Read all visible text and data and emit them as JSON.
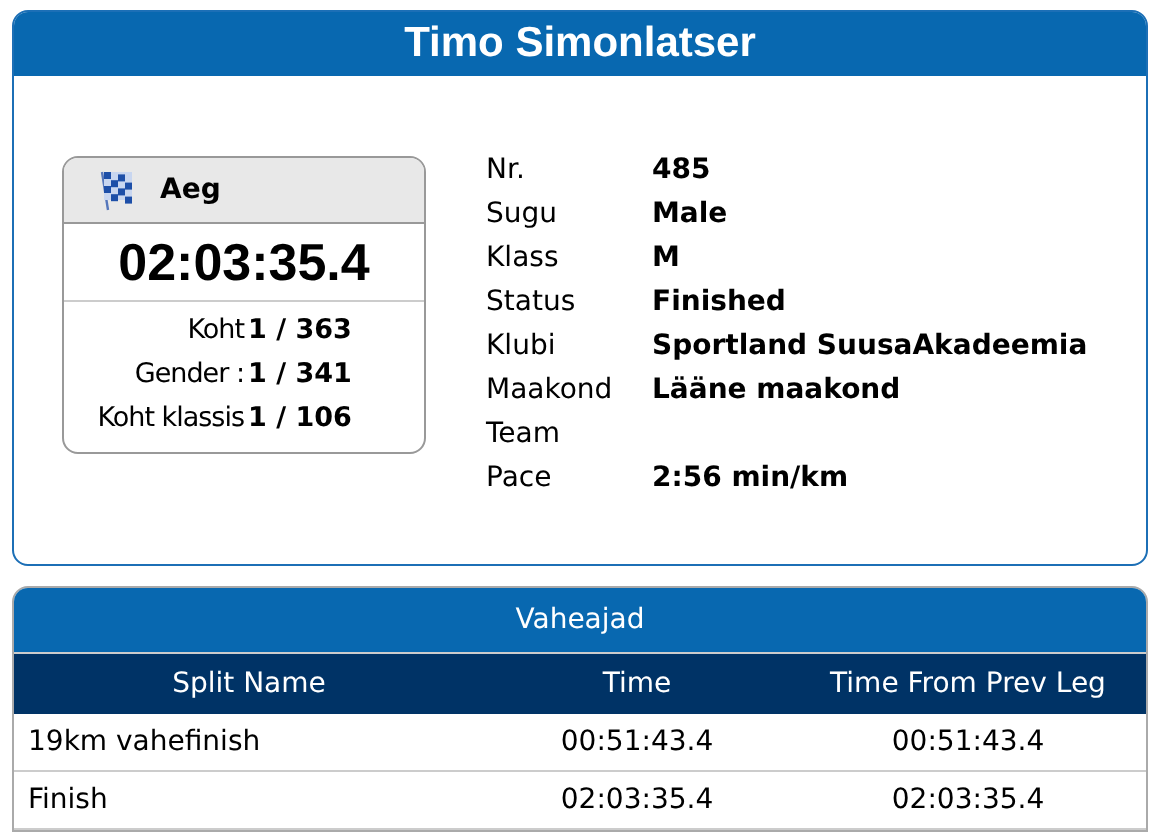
{
  "athlete": {
    "name": "Timo Simonlatser"
  },
  "result": {
    "title": "Aeg",
    "time": "02:03:35.4",
    "places": [
      {
        "label": "Koht",
        "value": "1 / 363"
      },
      {
        "label": "Gender :",
        "value": "1 / 341"
      },
      {
        "label": "Koht klassis",
        "value": "1 / 106"
      }
    ]
  },
  "details": [
    {
      "label": "Nr.",
      "value": "485"
    },
    {
      "label": "Sugu",
      "value": "Male"
    },
    {
      "label": "Klass",
      "value": "M"
    },
    {
      "label": "Status",
      "value": "Finished"
    },
    {
      "label": "Klubi",
      "value": "Sportland SuusaAkadeemia"
    },
    {
      "label": "Maakond",
      "value": "Lääne maakond"
    },
    {
      "label": "Team"
    },
    {
      "label": "Pace",
      "value": "2:56 min/km"
    }
  ],
  "splits": {
    "title": "Vaheajad",
    "columns": [
      "Split Name",
      "Time",
      "Time From Prev Leg"
    ],
    "rows": [
      [
        "19km vahefinish",
        "00:51:43.4",
        "00:51:43.4"
      ],
      [
        "Finish",
        "02:03:35.4",
        "02:03:35.4"
      ]
    ]
  }
}
